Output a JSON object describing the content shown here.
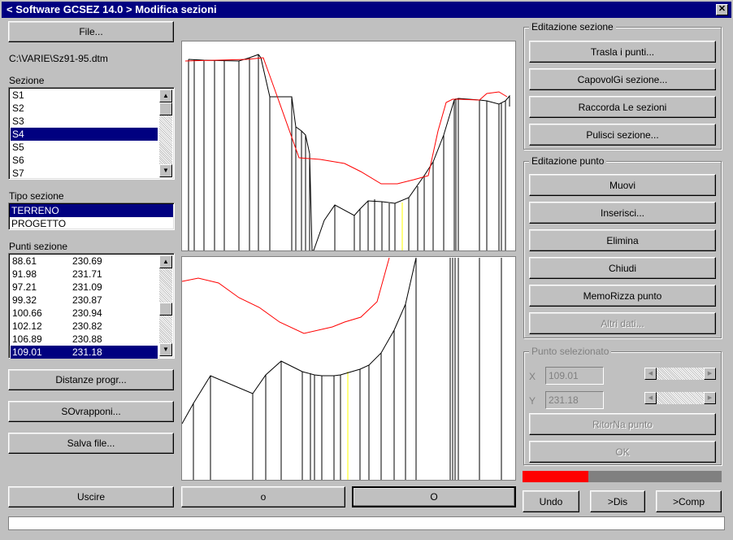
{
  "window": {
    "title": "< Software GCSEZ 14.0 >  Modifica sezioni",
    "close_glyph": "✕"
  },
  "left": {
    "file_button": "File...",
    "file_path": "C:\\VARIE\\Sz91-95.dtm",
    "sezione_label": "Sezione",
    "sezioni": [
      "S1",
      "S2",
      "S3",
      "S4",
      "S5",
      "S6",
      "S7"
    ],
    "sezione_selected_index": 3,
    "tipo_label": "Tipo sezione",
    "tipi": [
      "TERRENO",
      "PROGETTO"
    ],
    "tipo_selected_index": 0,
    "punti_label": "Punti sezione",
    "punti": [
      {
        "x": "88.61",
        "y": "230.69"
      },
      {
        "x": "91.98",
        "y": "231.71"
      },
      {
        "x": "97.21",
        "y": "231.09"
      },
      {
        "x": "99.32",
        "y": "230.87"
      },
      {
        "x": "100.66",
        "y": "230.94"
      },
      {
        "x": "102.12",
        "y": "230.82"
      },
      {
        "x": "106.89",
        "y": "230.88"
      },
      {
        "x": "109.01",
        "y": "231.18"
      }
    ],
    "punti_selected_index": 7,
    "distanze_button": "Distanze progr...",
    "sovrapponi_button": "SOvrapponi...",
    "salva_button": "Salva file...",
    "uscire_button": "Uscire"
  },
  "center": {
    "zoom_out_button": "o",
    "zoom_in_button": "O"
  },
  "editazione_sezione": {
    "title": "Editazione sezione",
    "trasla": "Trasla i punti...",
    "capovolgi": "CapovolGi sezione...",
    "raccorda": "Raccorda Le sezioni",
    "pulisci": "Pulisci sezione..."
  },
  "editazione_punto": {
    "title": "Editazione punto",
    "muovi": "Muovi",
    "inserisci": "Inserisci...",
    "elimina": "Elimina",
    "chiudi": "Chiudi",
    "memorizza": "MemoRizza punto",
    "altri": "Altri dati..."
  },
  "punto_selezionato": {
    "title": "Punto selezionato",
    "x_label": "X",
    "x_value": "109.01",
    "y_label": "Y",
    "y_value": "231.18",
    "ritorna": "RitorNa punto",
    "ok": "OK"
  },
  "bottom_right": {
    "undo": "Undo",
    "dis": ">Dis",
    "comp": ">Comp",
    "progress_fraction": 0.33
  },
  "colors": {
    "terrain_line": "#000000",
    "project_line": "#ff0000",
    "selected_vertical": "#ffff00",
    "progress": "#ff0000",
    "selection": "#000080"
  }
}
